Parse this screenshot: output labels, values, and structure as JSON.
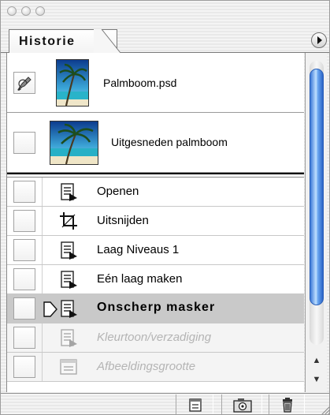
{
  "panel": {
    "tab_label": "Historie",
    "menu_button": "triangle-right-icon"
  },
  "snapshots": [
    {
      "label": "Palmboom.psd",
      "thumbnail": "palm-tree-portrait-icon",
      "has_source_brush": true
    },
    {
      "label": "Uitgesneden palmboom",
      "thumbnail": "palm-tree-landscape-icon",
      "has_source_brush": false
    }
  ],
  "history": [
    {
      "label": "Openen",
      "icon": "history-state-icon",
      "state": "normal"
    },
    {
      "label": "Uitsnijden",
      "icon": "crop-icon",
      "state": "normal"
    },
    {
      "label": "Laag Niveaus 1",
      "icon": "history-state-icon",
      "state": "normal"
    },
    {
      "label": "Eén laag maken",
      "icon": "history-state-icon",
      "state": "normal"
    },
    {
      "label": "Onscherp masker",
      "icon": "history-state-icon",
      "state": "active"
    },
    {
      "label": "Kleurtoon/verzadiging",
      "icon": "history-state-icon",
      "state": "dimmed"
    },
    {
      "label": "Afbeeldingsgrootte",
      "icon": "image-size-icon",
      "state": "dimmed"
    }
  ],
  "toolbar": {
    "new_document": "new-document-from-state-icon",
    "snapshot": "camera-snapshot-icon",
    "delete": "trash-icon"
  },
  "colors": {
    "active_row": "#c9c9c9",
    "scroll_thumb": "#3b78d8",
    "dimmed_text": "#b4b4b4"
  }
}
